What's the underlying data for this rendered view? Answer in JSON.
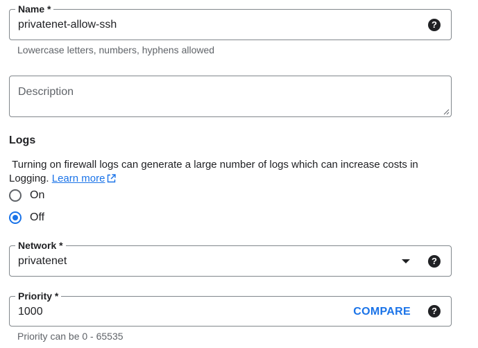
{
  "name_field": {
    "label": "Name *",
    "value": "privatenet-allow-ssh",
    "hint": "Lowercase letters, numbers, hyphens allowed",
    "help_icon": "help-circle-icon"
  },
  "description_field": {
    "placeholder": "Description",
    "value": ""
  },
  "logs": {
    "title": "Logs",
    "description": "Turning on firewall logs can generate a large number of logs which can increase costs in Logging.",
    "learn_more": "Learn more",
    "learn_more_icon": "external-link-icon",
    "options": [
      {
        "label": "On",
        "selected": false
      },
      {
        "label": "Off",
        "selected": true
      }
    ]
  },
  "network_field": {
    "label": "Network *",
    "value": "privatenet",
    "dropdown_icon": "dropdown-arrow-icon",
    "help_icon": "help-circle-icon"
  },
  "priority_field": {
    "label": "Priority *",
    "value": "1000",
    "compare_label": "COMPARE",
    "hint": "Priority can be 0 - 65535",
    "help_icon": "help-circle-icon"
  },
  "colors": {
    "accent": "#1a73e8",
    "text": "#202124",
    "muted": "#5f6368",
    "border": "#80868b"
  }
}
